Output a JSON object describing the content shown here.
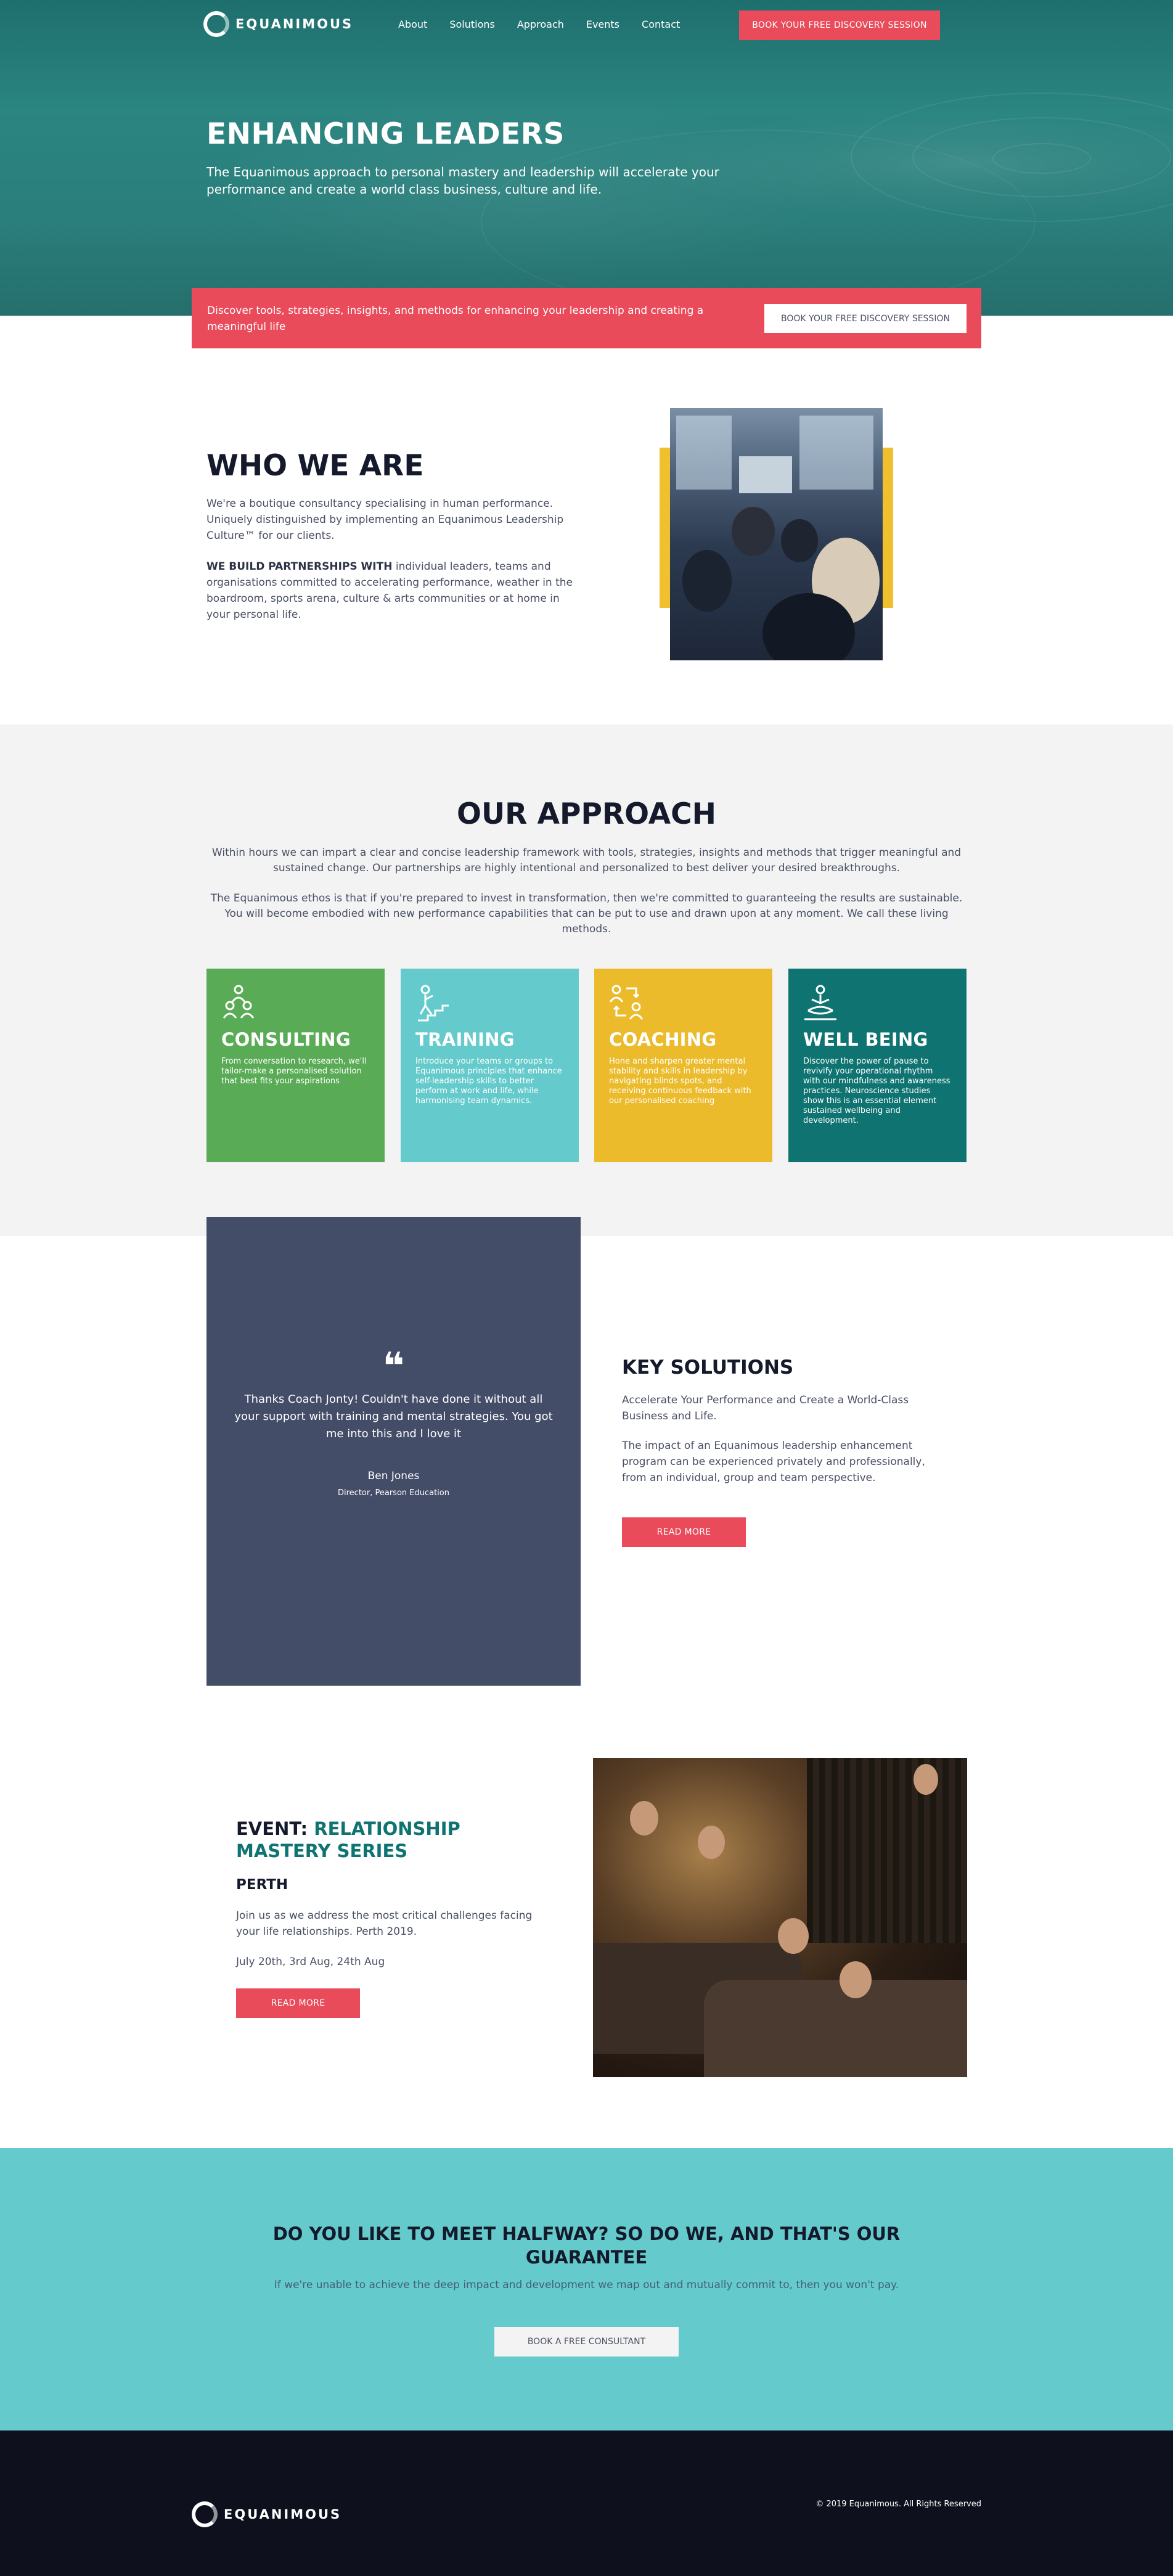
{
  "brand": {
    "name": "EQUANIMOUS"
  },
  "nav": {
    "items": [
      "About",
      "Solutions",
      "Approach",
      "Events",
      "Contact"
    ],
    "cta": "BOOK YOUR FREE DISCOVERY SESSION"
  },
  "hero": {
    "title": "ENHANCING LEADERS",
    "subtitle": "The Equanimous approach to personal mastery and leadership will accelerate your performance and create a world class business, culture and life."
  },
  "banner": {
    "text": "Discover tools, strategies, insights, and methods for enhancing your leadership and creating a meaningful life",
    "button": "BOOK YOUR FREE DISCOVERY SESSION"
  },
  "who": {
    "title": "WHO WE ARE",
    "p1": "We're a boutique consultancy specialising in human performance. Uniquely distinguished by implementing an Equanimous Leadership Culture™ for our clients.",
    "p2_bold": "WE BUILD PARTNERSHIPS WITH",
    "p2_rest": " individual leaders, teams and organisations committed to accelerating performance, weather in the boardroom, sports arena, culture & arts communities or at home in your personal life."
  },
  "approach": {
    "title": "OUR APPROACH",
    "p1": "Within hours we can impart a clear and concise leadership framework with tools, strategies, insights and methods that trigger meaningful and sustained change. Our partnerships are highly intentional and personalized to best deliver your desired breakthroughs.",
    "p2": "The Equanimous ethos is that if you're prepared to invest in transformation, then we're committed to guaranteeing the results are sustainable. You will become embodied with new performance capabilities that can be put to use and drawn upon at any moment. We call these living methods.",
    "cards": [
      {
        "title": "CONSULTING",
        "icon": "people-group-icon",
        "color": "#5aab56",
        "text": "From conversation to research, we'll tailor-make a personalised solution that best fits your aspirations"
      },
      {
        "title": "TRAINING",
        "icon": "person-stairs-icon",
        "color": "#64cacb",
        "text": "Introduce your teams or groups to Equanimous principles that enhance self-leadership skills to better perform at work and life, while harmonising team dynamics."
      },
      {
        "title": "COACHING",
        "icon": "coach-exchange-icon",
        "color": "#ebbb2c",
        "text": "Hone and sharpen greater mental stability and skills in leadership by navigating blinds spots, and receiving continuous feedback with our personalised coaching"
      },
      {
        "title": "WELL BEING",
        "icon": "meditation-icon",
        "color": "#0f7471",
        "text": "Discover the power of pause to revivify your operational rhythm with our mindfulness and awareness practices. Neuroscience studies show this is an essential element sustained wellbeing and development."
      }
    ]
  },
  "testimonial": {
    "quote_mark": "❝",
    "text": "Thanks Coach Jonty! Couldn't have done it without all your support with training and mental strategies. You got me into this and I love it",
    "name": "Ben Jones",
    "role": "Director, Pearson Education"
  },
  "key_solutions": {
    "title": "KEY SOLUTIONS",
    "p1": "Accelerate Your Performance and Create a World-Class Business and Life.",
    "p2": "The impact of an Equanimous leadership enhancement program can be experienced privately and professionally, from an individual, group and team perspective.",
    "button": "READ MORE"
  },
  "event": {
    "prefix": "EVENT: ",
    "title": "RELATIONSHIP MASTERY SERIES",
    "city": "PERTH",
    "text": "Join us as we address the most critical challenges facing your life relationships. Perth 2019.",
    "dates": "July 20th, 3rd Aug, 24th Aug",
    "button": "READ MORE"
  },
  "guarantee": {
    "title_line1": "DO YOU LIKE TO MEET HALFWAY? SO DO WE, AND THAT'S OUR",
    "title_line2": "GUARANTEE",
    "text": "If we're unable to achieve the deep impact and development we map out and mutually commit to, then you won't pay.",
    "button": "BOOK A FREE CONSULTANT"
  },
  "footer": {
    "copyright": "© 2019 Equanimous. All Rights Reserved"
  },
  "colors": {
    "teal_dark": "#0f7471",
    "teal_light": "#64cacb",
    "red": "#e94b5a",
    "green": "#5aab56",
    "yellow": "#ebbb2c",
    "navy": "#444d68",
    "footer": "#0e111d"
  }
}
